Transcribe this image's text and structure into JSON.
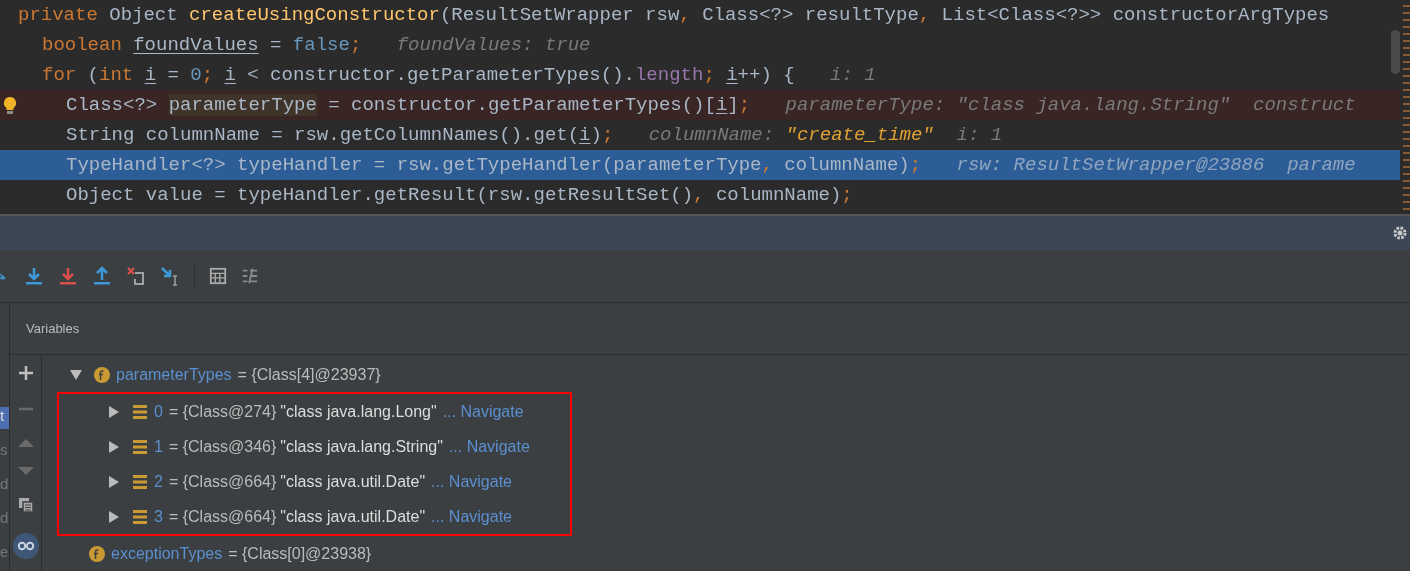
{
  "editor": {
    "lines": [
      {
        "breakpoint": false,
        "selected": false,
        "tokens": [
          {
            "text": "private",
            "kind": "keyword"
          },
          {
            "text": " Object ",
            "kind": "plain"
          },
          {
            "text": "createUsingConstructor",
            "kind": "method"
          },
          {
            "text": "(ResultSetWrapper rsw",
            "kind": "plain"
          },
          {
            "text": ", ",
            "kind": "keyword"
          },
          {
            "text": "Class<?> resultType",
            "kind": "plain"
          },
          {
            "text": ", ",
            "kind": "keyword"
          },
          {
            "text": "List<Class<?>> constructorArgTypes",
            "kind": "plain"
          }
        ],
        "children": [
          {
            "breakpoint": false,
            "selected": false,
            "tokens": [
              {
                "text": "boolean ",
                "kind": "keyword"
              },
              {
                "text": "foundValues",
                "kind": "var"
              },
              {
                "text": " = ",
                "kind": "plain"
              },
              {
                "text": "false",
                "kind": "number"
              },
              {
                "text": ";",
                "kind": "keyword"
              }
            ],
            "hints": [
              {
                "text": "foundValues: true",
                "kind": "hint"
              }
            ]
          },
          {
            "breakpoint": false,
            "selected": false,
            "tokens": [
              {
                "text": "for",
                "kind": "keyword"
              },
              {
                "text": " (",
                "kind": "plain"
              },
              {
                "text": "int ",
                "kind": "keyword"
              },
              {
                "text": "i",
                "kind": "var"
              },
              {
                "text": " = ",
                "kind": "plain"
              },
              {
                "text": "0",
                "kind": "number"
              },
              {
                "text": "; ",
                "kind": "keyword"
              },
              {
                "text": "i",
                "kind": "var"
              },
              {
                "text": " < constructor.getParameterTypes().",
                "kind": "plain"
              },
              {
                "text": "length",
                "kind": "field"
              },
              {
                "text": "; ",
                "kind": "keyword"
              },
              {
                "text": "i",
                "kind": "var"
              },
              {
                "text": "++) {",
                "kind": "plain"
              }
            ],
            "hints": [
              {
                "text": "i: 1",
                "kind": "hint"
              }
            ],
            "children": [
              {
                "breakpoint": true,
                "selected": false,
                "tokens": [
                  {
                    "text": "Class<?> ",
                    "kind": "plain"
                  },
                  {
                    "text": "parameterType",
                    "kind": "usage"
                  },
                  {
                    "text": " = constructor.getParameterTypes()[",
                    "kind": "plain"
                  },
                  {
                    "text": "i",
                    "kind": "var"
                  },
                  {
                    "text": "]",
                    "kind": "plain"
                  },
                  {
                    "text": ";",
                    "kind": "keyword"
                  }
                ],
                "hints": [
                  {
                    "text": "parameterType: \"class java.lang.String\"  construct",
                    "kind": "hint"
                  }
                ]
              },
              {
                "breakpoint": false,
                "selected": false,
                "tokens": [
                  {
                    "text": "String columnName = rsw.getColumnNames().get(",
                    "kind": "plain"
                  },
                  {
                    "text": "i",
                    "kind": "var"
                  },
                  {
                    "text": ")",
                    "kind": "plain"
                  },
                  {
                    "text": ";",
                    "kind": "keyword"
                  }
                ],
                "hints": [
                  {
                    "text": "columnName: ",
                    "kind": "hint"
                  },
                  {
                    "text": "\"create_time\"",
                    "kind": "hint-string"
                  },
                  {
                    "text": "  i: 1",
                    "kind": "hint"
                  }
                ]
              },
              {
                "breakpoint": false,
                "selected": true,
                "tokens": [
                  {
                    "text": "TypeHandler<?> typeHandler = rsw.getTypeHandler(parameterType",
                    "kind": "plain"
                  },
                  {
                    "text": ", ",
                    "kind": "keyword"
                  },
                  {
                    "text": "columnName)",
                    "kind": "plain"
                  },
                  {
                    "text": ";",
                    "kind": "keyword"
                  }
                ],
                "hints": [
                  {
                    "text": "rsw: ResultSetWrapper@23886  parame",
                    "kind": "hint"
                  }
                ]
              },
              {
                "breakpoint": false,
                "selected": false,
                "tokens": [
                  {
                    "text": "Object value = typeHandler.getResult(rsw.getResultSet()",
                    "kind": "plain"
                  },
                  {
                    "text": ", ",
                    "kind": "keyword"
                  },
                  {
                    "text": "columnName)",
                    "kind": "plain"
                  },
                  {
                    "text": ";",
                    "kind": "keyword"
                  }
                ]
              }
            ]
          }
        ]
      }
    ]
  },
  "frames": [
    {
      "text": "t",
      "selected": true
    },
    {
      "text": "s",
      "selected": false
    },
    {
      "text": "d",
      "selected": false
    },
    {
      "text": "d",
      "selected": false
    },
    {
      "text": "e",
      "selected": false
    }
  ],
  "variables": {
    "title": "Variables",
    "tree": [
      {
        "kind": "field",
        "name": "parameterTypes",
        "value": "= {Class[4]@23937}",
        "expanded": true,
        "outlined": true,
        "children": [
          {
            "kind": "element",
            "name": "0",
            "value": "= {Class@274}",
            "text": "\"class java.lang.Long\"",
            "link": "... Navigate",
            "expanded": false
          },
          {
            "kind": "element",
            "name": "1",
            "value": "= {Class@346}",
            "text": "\"class java.lang.String\"",
            "link": "... Navigate",
            "expanded": false
          },
          {
            "kind": "element",
            "name": "2",
            "value": "= {Class@664}",
            "text": "\"class java.util.Date\"",
            "link": "... Navigate",
            "expanded": false
          },
          {
            "kind": "element",
            "name": "3",
            "value": "= {Class@664}",
            "text": "\"class java.util.Date\"",
            "link": "... Navigate",
            "expanded": false
          }
        ]
      },
      {
        "kind": "field",
        "name": "exceptionTypes",
        "value": "= {Class[0]@23938}"
      }
    ]
  }
}
